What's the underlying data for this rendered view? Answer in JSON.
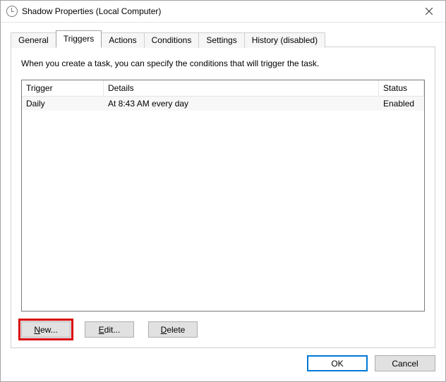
{
  "window": {
    "title": "Shadow Properties (Local Computer)",
    "close_label": "Close"
  },
  "tabs": [
    {
      "label": "General"
    },
    {
      "label": "Triggers",
      "active": true
    },
    {
      "label": "Actions"
    },
    {
      "label": "Conditions"
    },
    {
      "label": "Settings"
    },
    {
      "label": "History (disabled)"
    }
  ],
  "page": {
    "description": "When you create a task, you can specify the conditions that will trigger the task."
  },
  "listview": {
    "columns": {
      "trigger": "Trigger",
      "details": "Details",
      "status": "Status"
    },
    "rows": [
      {
        "trigger": "Daily",
        "details": "At 8:43 AM every day",
        "status": "Enabled"
      }
    ]
  },
  "buttons": {
    "new": "New...",
    "edit": "Edit...",
    "delete": "Delete",
    "ok": "OK",
    "cancel": "Cancel"
  }
}
